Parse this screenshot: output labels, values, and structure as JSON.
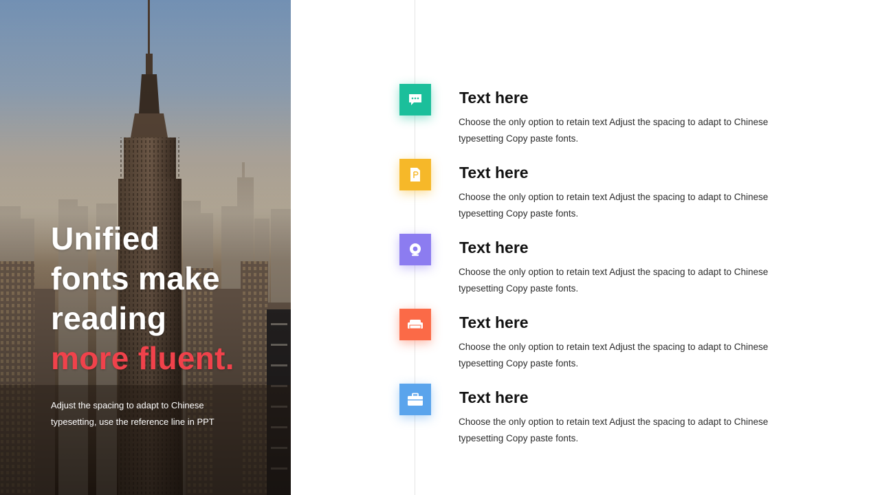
{
  "hero": {
    "heading_lines": [
      "Unified",
      "fonts make",
      "reading"
    ],
    "heading_accent": "more fluent.",
    "subtitle": "Adjust the spacing to adapt to Chinese typesetting, use the reference line in PPT"
  },
  "colors": {
    "accent_red": "#f0424b",
    "teal": "#1bbf9b",
    "yellow": "#f6b829",
    "purple": "#8c7cf0",
    "orange": "#fb6a47",
    "blue": "#5aa4ec"
  },
  "items": [
    {
      "title": "Text here",
      "description": "Choose the only option to retain text Adjust the spacing to adapt to Chinese typesetting Copy paste fonts.",
      "icon": "chat-bubble-icon",
      "color": "#1bbf9b"
    },
    {
      "title": "Text here",
      "description": "Choose the only option to retain text Adjust the spacing to adapt to Chinese typesetting Copy paste fonts.",
      "icon": "document-icon",
      "color": "#f6b829"
    },
    {
      "title": "Text here",
      "description": "Choose the only option to retain text Adjust the spacing to adapt to Chinese typesetting Copy paste fonts.",
      "icon": "webcam-icon",
      "color": "#8c7cf0"
    },
    {
      "title": "Text here",
      "description": "Choose the only option to retain text Adjust the spacing to adapt to Chinese typesetting Copy paste fonts.",
      "icon": "sofa-icon",
      "color": "#fb6a47"
    },
    {
      "title": "Text here",
      "description": "Choose the only option to retain text Adjust the spacing to adapt to Chinese typesetting Copy paste fonts.",
      "icon": "briefcase-icon",
      "color": "#5aa4ec"
    }
  ]
}
